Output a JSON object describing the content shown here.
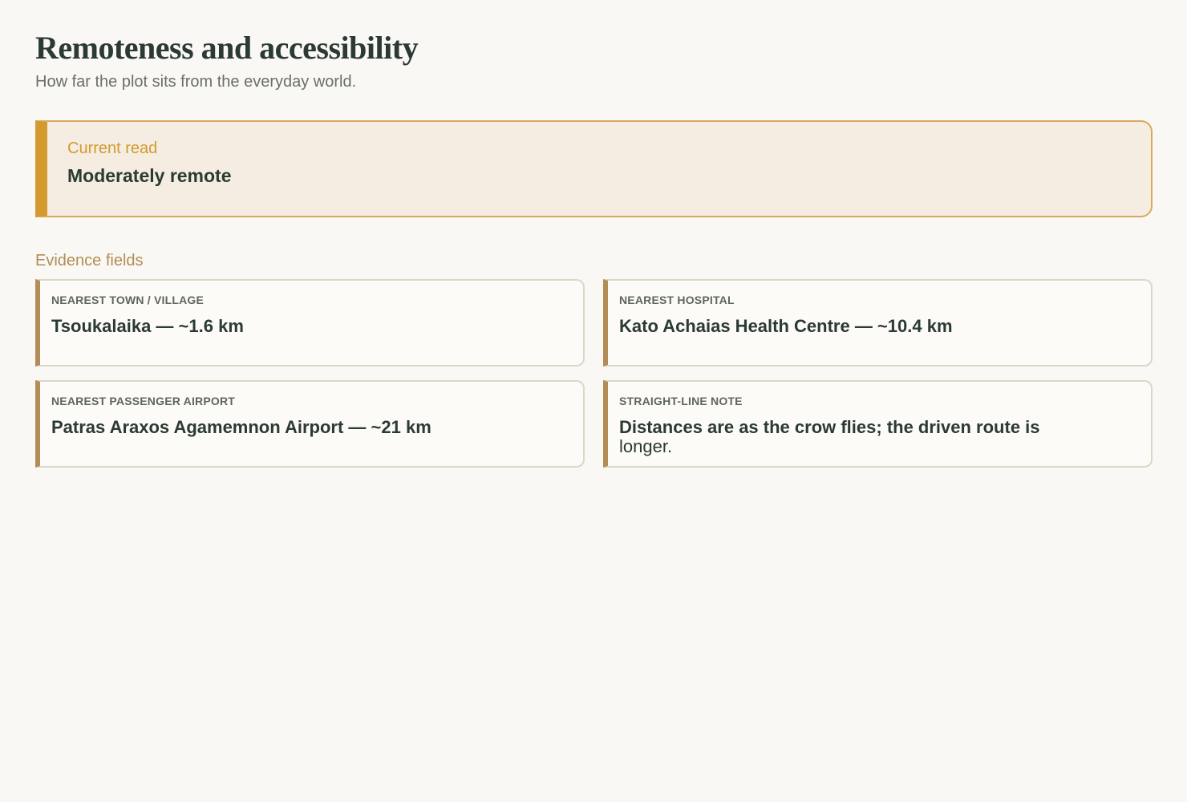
{
  "header": {
    "title": "Remoteness and accessibility",
    "subtitle": "How far the plot sits from the everyday world."
  },
  "status": {
    "label": "Current read",
    "value": "Moderately remote"
  },
  "evidence": {
    "heading": "Evidence fields",
    "fields": [
      {
        "label": "NEAREST TOWN / VILLAGE",
        "value": "Tsoukalaika — ~1.6 km"
      },
      {
        "label": "NEAREST HOSPITAL",
        "value": "Kato Achaias Health Centre — ~10.4 km"
      },
      {
        "label": "NEAREST PASSENGER AIRPORT",
        "value": "Patras Araxos Agamemnon Airport — ~21 km"
      },
      {
        "label": "STRAIGHT-LINE NOTE",
        "value": "Distances are as the crow flies; the driven route is",
        "value_tail": "longer."
      }
    ]
  },
  "colors": {
    "background": "#faf8f4",
    "accent": "#d4992f",
    "accent_muted": "#b28d55",
    "text": "#2b3a33"
  }
}
